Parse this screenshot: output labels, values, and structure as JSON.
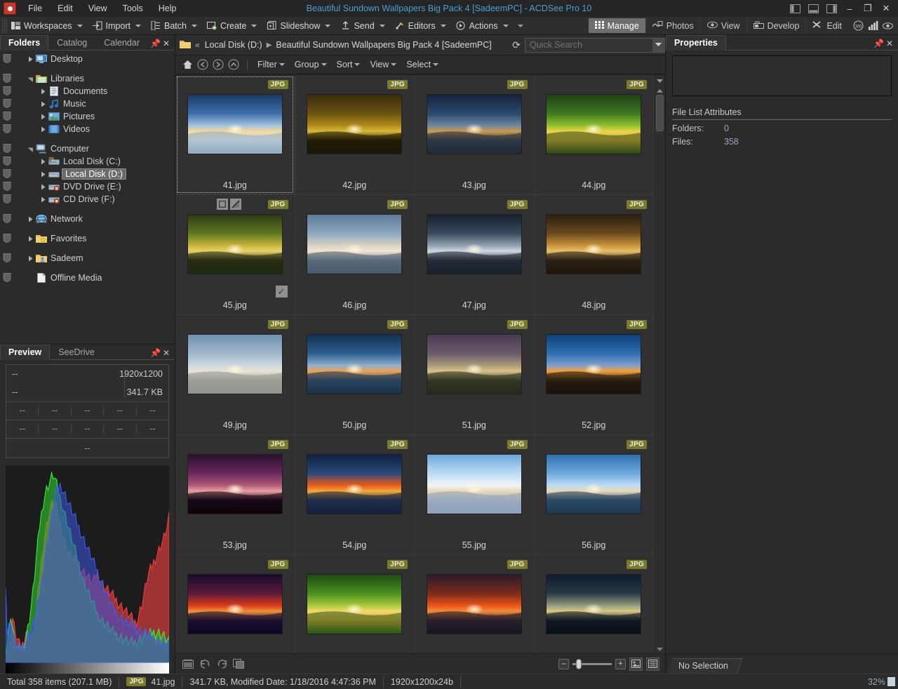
{
  "window": {
    "title": "Beautiful Sundown Wallpapers Big Pack 4 [SadeemPC] - ACDSee Pro 10",
    "minimize": "–",
    "restore": "❐",
    "close": "✕"
  },
  "menubar": {
    "items": [
      "File",
      "Edit",
      "View",
      "Tools",
      "Help"
    ]
  },
  "toolbar": {
    "items": [
      {
        "label": "Workspaces",
        "icon": "workspaces-icon"
      },
      {
        "label": "Import",
        "icon": "import-icon"
      },
      {
        "label": "Batch",
        "icon": "batch-icon"
      },
      {
        "label": "Create",
        "icon": "create-icon"
      },
      {
        "label": "Slideshow",
        "icon": "slideshow-icon"
      },
      {
        "label": "Send",
        "icon": "send-icon"
      },
      {
        "label": "Editors",
        "icon": "editors-icon"
      },
      {
        "label": "Actions",
        "icon": "actions-icon"
      }
    ],
    "modes": [
      {
        "label": "Manage",
        "icon": "manage-icon",
        "active": true
      },
      {
        "label": "Photos",
        "icon": "photos-icon",
        "active": false
      },
      {
        "label": "View",
        "icon": "view-icon",
        "active": false
      },
      {
        "label": "Develop",
        "icon": "develop-icon",
        "active": false
      },
      {
        "label": "Edit",
        "icon": "edit-icon",
        "active": false
      }
    ],
    "mode_icons": [
      "365-icon",
      "chart-icon",
      "eye-icon"
    ]
  },
  "left_panel": {
    "tabs": [
      {
        "label": "Folders",
        "active": true
      },
      {
        "label": "Catalog",
        "active": false
      },
      {
        "label": "Calendar",
        "active": false
      }
    ],
    "pin": "pin-icon",
    "close": "close-icon",
    "tree": [
      {
        "label": "Desktop",
        "indent": 1,
        "icon": "desktop-icon",
        "expander": "collapsed",
        "selected": false,
        "gapAfter": true
      },
      {
        "label": "Libraries",
        "indent": 1,
        "icon": "library-icon",
        "expander": "expanded",
        "selected": false
      },
      {
        "label": "Documents",
        "indent": 2,
        "icon": "documents-icon",
        "expander": "collapsed",
        "selected": false
      },
      {
        "label": "Music",
        "indent": 2,
        "icon": "music-icon",
        "expander": "collapsed",
        "selected": false
      },
      {
        "label": "Pictures",
        "indent": 2,
        "icon": "pictures-icon",
        "expander": "collapsed",
        "selected": false
      },
      {
        "label": "Videos",
        "indent": 2,
        "icon": "videos-icon",
        "expander": "collapsed",
        "selected": false,
        "gapAfter": true
      },
      {
        "label": "Computer",
        "indent": 1,
        "icon": "computer-icon",
        "expander": "expanded",
        "selected": false
      },
      {
        "label": "Local Disk (C:)",
        "indent": 2,
        "icon": "hdd-sys-icon",
        "expander": "collapsed",
        "selected": false
      },
      {
        "label": "Local Disk (D:)",
        "indent": 2,
        "icon": "hdd-icon",
        "expander": "collapsed",
        "selected": true
      },
      {
        "label": "DVD Drive (E:)",
        "indent": 2,
        "icon": "dvd-icon",
        "expander": "collapsed",
        "selected": false
      },
      {
        "label": "CD Drive (F:)",
        "indent": 2,
        "icon": "cd-icon",
        "expander": "collapsed",
        "selected": false,
        "gapAfter": true
      },
      {
        "label": "Network",
        "indent": 1,
        "icon": "network-icon",
        "expander": "collapsed",
        "selected": false,
        "gapAfter": true
      },
      {
        "label": "Favorites",
        "indent": 1,
        "icon": "favorites-icon",
        "expander": "collapsed",
        "selected": false,
        "gapAfter": true
      },
      {
        "label": "Sadeem",
        "indent": 1,
        "icon": "user-folder-icon",
        "expander": "collapsed",
        "selected": false,
        "gapAfter": true
      },
      {
        "label": "Offline Media",
        "indent": 1,
        "icon": "offline-icon",
        "expander": "none",
        "selected": false
      }
    ]
  },
  "preview_panel": {
    "tabs": [
      {
        "label": "Preview",
        "active": true
      },
      {
        "label": "SeeDrive",
        "active": false
      }
    ],
    "pin": "pin-icon",
    "close": "close-icon",
    "meta": {
      "left_top": "--",
      "right_top": "1920x1200",
      "left_bottom": "--",
      "right_bottom": "341.7 KB",
      "row1": [
        "--",
        "--",
        "--",
        "--",
        "--"
      ],
      "row2": [
        "--",
        "--",
        "--",
        "--",
        "--"
      ],
      "full": "--"
    },
    "histogram": {
      "red": [
        8,
        6,
        7,
        14,
        22,
        18,
        14,
        11,
        9,
        8,
        9,
        12,
        16,
        14,
        12,
        11,
        13,
        18,
        24,
        33,
        42,
        50,
        57,
        63,
        68,
        72,
        75,
        78,
        80,
        79,
        76,
        72,
        69,
        66,
        63,
        60,
        57,
        55,
        53,
        52,
        51,
        50,
        49,
        48,
        47,
        46,
        45,
        44,
        43,
        42,
        41,
        40,
        41,
        43,
        44,
        43,
        41,
        39,
        38,
        37,
        36,
        35,
        34,
        33,
        32,
        31,
        30,
        29,
        28,
        27,
        26,
        25,
        24,
        23,
        22,
        21,
        20,
        21,
        23,
        26,
        29,
        33,
        37,
        41,
        44,
        46,
        48,
        50,
        52,
        54,
        56,
        58,
        60,
        62,
        65,
        68,
        72
      ],
      "green": [
        7,
        10,
        16,
        24,
        18,
        12,
        9,
        7,
        6,
        7,
        8,
        10,
        13,
        17,
        22,
        28,
        35,
        43,
        52,
        60,
        68,
        74,
        79,
        83,
        86,
        88,
        90,
        92,
        93,
        91,
        88,
        85,
        82,
        79,
        76,
        73,
        70,
        67,
        64,
        61,
        58,
        55,
        52,
        49,
        46,
        43,
        40,
        38,
        36,
        34,
        32,
        30,
        28,
        26,
        24,
        23,
        22,
        21,
        20,
        19,
        18,
        17,
        16,
        15,
        15,
        14,
        14,
        13,
        13,
        12,
        12,
        11,
        11,
        10,
        10,
        10,
        10,
        11,
        11,
        12,
        12,
        13,
        13,
        14,
        14,
        14,
        15,
        15,
        15,
        15,
        15,
        14,
        14,
        13,
        12,
        11,
        10
      ],
      "blue": [
        40,
        14,
        18,
        22,
        16,
        11,
        9,
        8,
        7,
        7,
        8,
        9,
        11,
        13,
        15,
        17,
        19,
        22,
        25,
        29,
        34,
        40,
        46,
        52,
        58,
        63,
        68,
        73,
        78,
        82,
        85,
        87,
        88,
        87,
        85,
        83,
        81,
        79,
        77,
        75,
        73,
        71,
        69,
        67,
        65,
        63,
        61,
        59,
        57,
        55,
        53,
        51,
        49,
        47,
        45,
        43,
        41,
        39,
        37,
        35,
        33,
        31,
        29,
        27,
        26,
        25,
        24,
        23,
        22,
        21,
        21,
        20,
        20,
        19,
        19,
        18,
        18,
        17,
        17,
        16,
        16,
        15,
        15,
        14,
        14,
        13,
        13,
        12,
        12,
        11,
        11,
        11,
        10,
        10,
        9,
        9,
        8
      ]
    }
  },
  "breadcrumb": {
    "folder_icon": "folder-icon",
    "back_chevrons": "«",
    "path": [
      "Local Disk (D:)",
      "Beautiful Sundown Wallpapers Big Pack 4 [SadeemPC]"
    ],
    "separator": "▶",
    "refresh_icon": "refresh-icon"
  },
  "search": {
    "placeholder": "Quick Search",
    "value": "",
    "dropdown_icon": "chevron-down-icon"
  },
  "navbar": {
    "icons": [
      "home-icon",
      "back-icon",
      "forward-icon",
      "up-icon"
    ],
    "menus": [
      "Filter",
      "Group",
      "Sort",
      "View",
      "Select"
    ]
  },
  "grid": {
    "badge_label": "JPG",
    "items": [
      {
        "name": "41.jpg",
        "selected": true,
        "hover": false,
        "checked": false,
        "thumb": "snow-fjord-sunrise"
      },
      {
        "name": "42.jpg",
        "selected": false,
        "hover": false,
        "checked": false,
        "thumb": "golden-tree-field"
      },
      {
        "name": "43.jpg",
        "selected": false,
        "hover": false,
        "checked": false,
        "thumb": "rocky-coast-dusk"
      },
      {
        "name": "44.jpg",
        "selected": false,
        "hover": false,
        "checked": false,
        "thumb": "green-field-sunset"
      },
      {
        "name": "45.jpg",
        "selected": false,
        "hover": true,
        "checked": true,
        "thumb": "lake-cabin-dawn"
      },
      {
        "name": "46.jpg",
        "selected": false,
        "hover": false,
        "checked": false,
        "thumb": "sunbeam-clouds-sea"
      },
      {
        "name": "47.jpg",
        "selected": false,
        "hover": false,
        "checked": false,
        "thumb": "misty-lake-tree"
      },
      {
        "name": "48.jpg",
        "selected": false,
        "hover": false,
        "checked": false,
        "thumb": "snow-tree-shadow"
      },
      {
        "name": "49.jpg",
        "selected": false,
        "hover": false,
        "checked": false,
        "thumb": "winter-field-pale"
      },
      {
        "name": "50.jpg",
        "selected": false,
        "hover": false,
        "checked": false,
        "thumb": "shore-sunset-clouds"
      },
      {
        "name": "51.jpg",
        "selected": false,
        "hover": false,
        "checked": false,
        "thumb": "stone-cross-hill"
      },
      {
        "name": "52.jpg",
        "selected": false,
        "hover": false,
        "checked": false,
        "thumb": "basalt-ruins-sunset"
      },
      {
        "name": "53.jpg",
        "selected": false,
        "hover": false,
        "checked": false,
        "thumb": "purple-lake-trees"
      },
      {
        "name": "54.jpg",
        "selected": false,
        "hover": false,
        "checked": false,
        "thumb": "snow-sunburst-orange"
      },
      {
        "name": "55.jpg",
        "selected": false,
        "hover": false,
        "checked": false,
        "thumb": "snow-village-sunstar"
      },
      {
        "name": "56.jpg",
        "selected": false,
        "hover": false,
        "checked": false,
        "thumb": "foggy-bridge-blue"
      },
      {
        "name": "",
        "selected": false,
        "hover": false,
        "checked": false,
        "thumb": "red-forest-sunrise"
      },
      {
        "name": "",
        "selected": false,
        "hover": false,
        "checked": false,
        "thumb": "green-hills-path"
      },
      {
        "name": "",
        "selected": false,
        "hover": false,
        "checked": false,
        "thumb": "pier-fire-sky"
      },
      {
        "name": "",
        "selected": false,
        "hover": false,
        "checked": false,
        "thumb": "dark-stone-storm"
      }
    ]
  },
  "grid_footer": {
    "icons": [
      "filmstrip-icon",
      "rotate-left-icon",
      "rotate-right-icon",
      "compare-icon"
    ],
    "zoom_minus": "–",
    "zoom_plus": "+",
    "view_thumb_icon": "thumbnail-view-icon",
    "view_list_icon": "list-view-icon"
  },
  "properties_panel": {
    "tab": "Properties",
    "pin": "pin-icon",
    "close": "close-icon",
    "section_title": "File List Attributes",
    "rows": [
      {
        "key": "Folders:",
        "value": "0"
      },
      {
        "key": "Files:",
        "value": "358"
      }
    ],
    "footer_tab": "No Selection"
  },
  "statusbar": {
    "total": "Total 358 items  (207.1 MB)",
    "badge": "JPG",
    "filename": "41.jpg",
    "details": "341.7 KB, Modified Date: 1/18/2016 4:47:36 PM",
    "dimensions": "1920x1200x24b",
    "percent": "32%"
  },
  "colors": {
    "accent": "#4a9fd4",
    "badge": "#7b7b30",
    "window_bg": "#2b2b2b",
    "panel_bg": "#2e2e2e",
    "selection": "#6b6b6b"
  }
}
